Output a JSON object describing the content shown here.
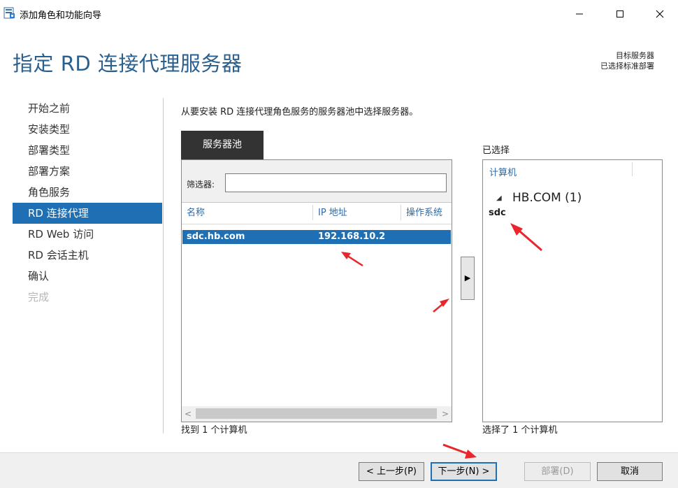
{
  "window": {
    "title": "添加角色和功能向导"
  },
  "header": {
    "title": "指定 RD 连接代理服务器",
    "target_label": "目标服务器",
    "target_value": "已选择标准部署"
  },
  "nav": {
    "items": [
      {
        "label": "开始之前",
        "state": "normal"
      },
      {
        "label": "安装类型",
        "state": "normal"
      },
      {
        "label": "部署类型",
        "state": "normal"
      },
      {
        "label": "部署方案",
        "state": "normal"
      },
      {
        "label": "角色服务",
        "state": "normal"
      },
      {
        "label": "RD 连接代理",
        "state": "active"
      },
      {
        "label": "RD Web 访问",
        "state": "normal"
      },
      {
        "label": "RD 会话主机",
        "state": "normal"
      },
      {
        "label": "确认",
        "state": "normal"
      },
      {
        "label": "完成",
        "state": "disabled"
      }
    ]
  },
  "main": {
    "instruction": "从要安装 RD 连接代理角色服务的服务器池中选择服务器。",
    "pool_tab": "服务器池",
    "filter_label": "筛选器:",
    "filter_value": "",
    "columns": [
      "名称",
      "IP 地址",
      "操作系统"
    ],
    "rows": [
      {
        "name": "sdc.hb.com",
        "ip": "192.168.10.2",
        "os": ""
      }
    ],
    "found_count": "找到 1 个计算机",
    "add_button": "▶"
  },
  "selected": {
    "label": "已选择",
    "column": "计算机",
    "group": "HB.COM (1)",
    "group_toggle": "◢",
    "items": [
      "sdc"
    ],
    "count": "选择了 1 个计算机"
  },
  "footer": {
    "prev": "< 上一步(P)",
    "next": "下一步(N) >",
    "deploy": "部署(D)",
    "cancel": "取消"
  },
  "colors": {
    "accent": "#1f6fb5",
    "header_text": "#2a5f8e",
    "annotation_arrow": "#e8262c",
    "tab_dark": "#333333"
  }
}
